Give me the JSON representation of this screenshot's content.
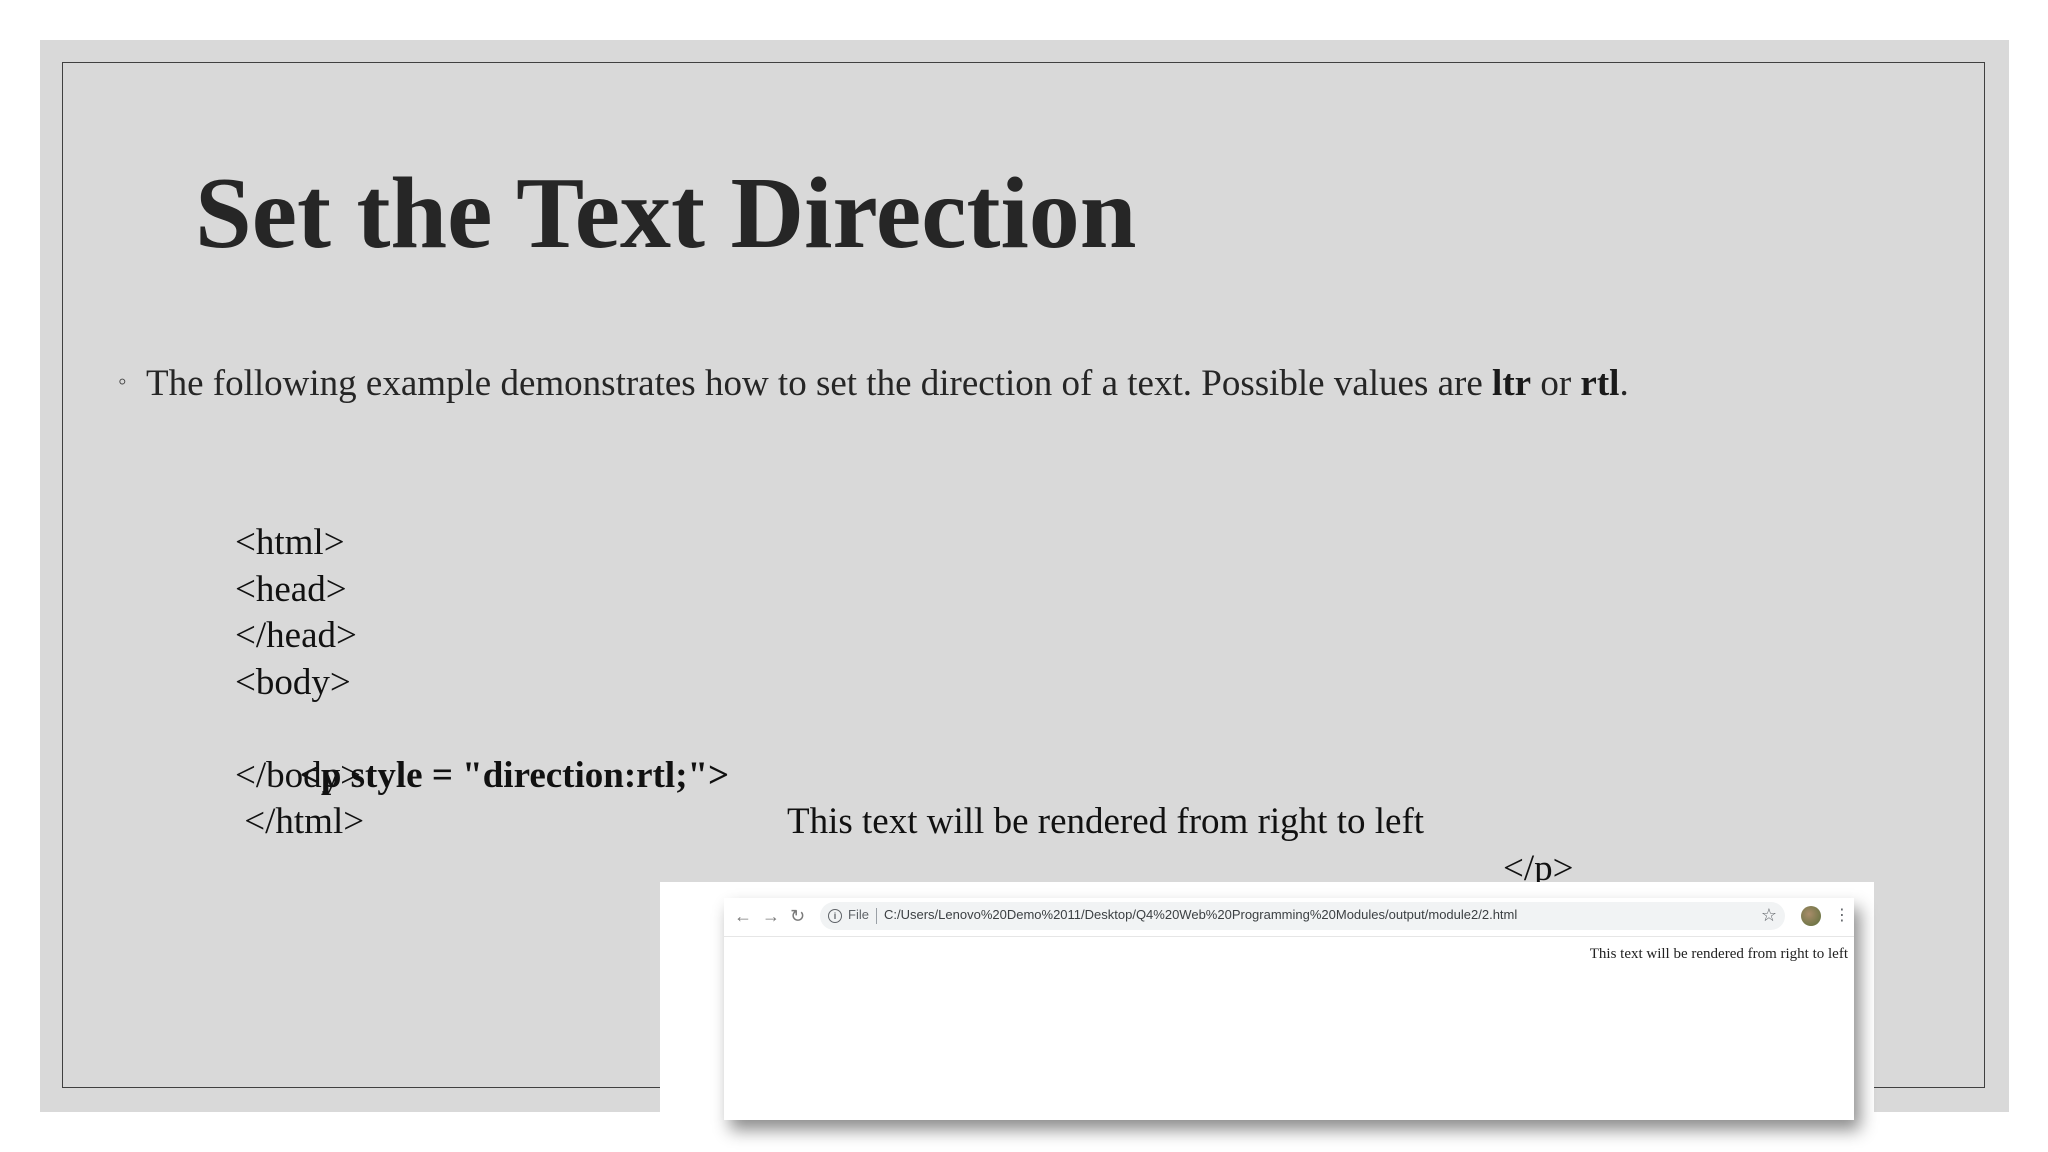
{
  "slide": {
    "title": "Set the Text Direction",
    "bullet": {
      "text_before": "The following example demonstrates how to set the direction of a text. Possible values are ",
      "value1": "ltr",
      "connector": " or ",
      "value2": "rtl",
      "period": "."
    },
    "code": {
      "line1": "<html>",
      "line2": "<head>",
      "line3": "</head>",
      "line4": "<body>",
      "line5_tag": " <p style = \"direction:rtl;\">",
      "line5_text": "This text will be rendered from right to left",
      "line5_end": "</p>",
      "line6": "</body>",
      "line7": " </html>"
    }
  },
  "browser": {
    "file_label": "File",
    "url": "C:/Users/Lenovo%20Demo%2011/Desktop/Q4%20Web%20Programming%20Modules/output/module2/2.html",
    "rendered_text": "This text will be rendered from right to left",
    "icons": [
      "back-icon",
      "forward-icon",
      "reload-icon",
      "info-icon",
      "star-icon",
      "avatar",
      "menu-icon"
    ]
  }
}
